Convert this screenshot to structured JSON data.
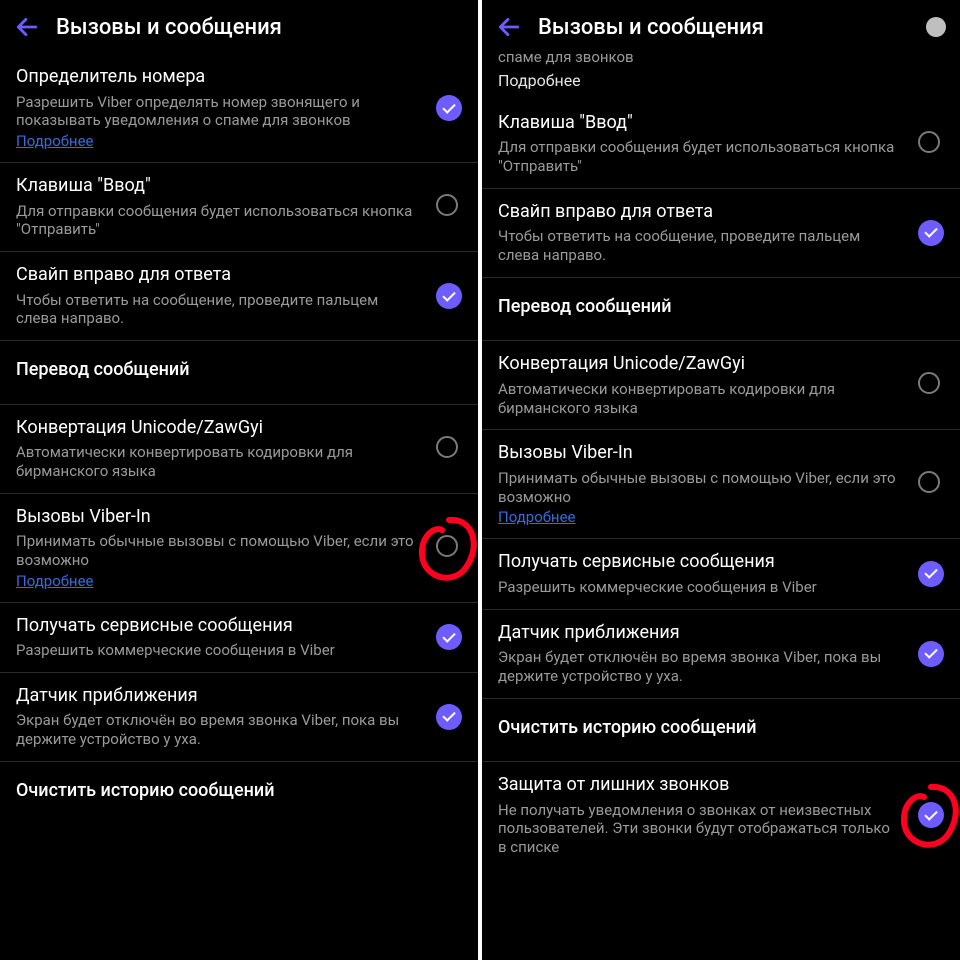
{
  "common": {
    "screen_title": "Вызовы и сообщения",
    "more_link": "Подробнее"
  },
  "left": {
    "items": [
      {
        "kind": "toggle",
        "title": "Определитель номера",
        "desc": "Разрешить Viber определять номер звонящего и показывать уведомления о спаме для звонков",
        "link": true,
        "on": true
      },
      {
        "kind": "toggle",
        "title": "Клавиша \"Ввод\"",
        "desc": "Для отправки сообщения будет использоваться кнопка \"Отправить\"",
        "on": false
      },
      {
        "kind": "toggle",
        "title": "Свайп вправо для ответа",
        "desc": "Чтобы ответить на сообщение, проведите пальцем слева направо.",
        "on": true
      },
      {
        "kind": "header",
        "title": "Перевод сообщений"
      },
      {
        "kind": "toggle",
        "title": "Конвертация Unicode/ZawGyi",
        "desc": "Автоматически конвертировать кодировки для бирманского языка",
        "on": false
      },
      {
        "kind": "toggle",
        "title": "Вызовы Viber-In",
        "desc": "Принимать обычные вызовы с помощью Viber, если это возможно",
        "link": true,
        "on": false,
        "annot": true
      },
      {
        "kind": "toggle",
        "title": "Получать сервисные сообщения",
        "desc": "Разрешить коммерческие сообщения в Viber",
        "on": true
      },
      {
        "kind": "toggle",
        "title": "Датчик приближения",
        "desc": "Экран будет отключён во время звонка Viber, пока вы держите устройство у уха.",
        "on": true
      },
      {
        "kind": "header",
        "title": "Очистить историю сообщений"
      }
    ]
  },
  "right": {
    "cutoff_desc": "спаме для звонков",
    "items": [
      {
        "kind": "toggle",
        "title": "Клавиша \"Ввод\"",
        "desc": "Для отправки сообщения будет использоваться кнопка \"Отправить\"",
        "on": false
      },
      {
        "kind": "toggle",
        "title": "Свайп вправо для ответа",
        "desc": "Чтобы ответить на сообщение, проведите пальцем слева направо.",
        "on": true
      },
      {
        "kind": "header",
        "title": "Перевод сообщений"
      },
      {
        "kind": "toggle",
        "title": "Конвертация Unicode/ZawGyi",
        "desc": "Автоматически конвертировать кодировки для бирманского языка",
        "on": false
      },
      {
        "kind": "toggle",
        "title": "Вызовы Viber-In",
        "desc": "Принимать обычные вызовы с помощью Viber, если это возможно",
        "link": true,
        "on": false
      },
      {
        "kind": "toggle",
        "title": "Получать сервисные сообщения",
        "desc": "Разрешить коммерческие сообщения в Viber",
        "on": true
      },
      {
        "kind": "toggle",
        "title": "Датчик приближения",
        "desc": "Экран будет отключён во время звонка Viber, пока вы держите устройство у уха.",
        "on": true
      },
      {
        "kind": "header",
        "title": "Очистить историю сообщений"
      },
      {
        "kind": "toggle",
        "title": "Защита от лишних звонков",
        "desc": "Не получать уведомления о звонках от неизвестных пользователей. Эти звонки будут отображаться только в списке",
        "on": true,
        "annot": true
      }
    ]
  }
}
